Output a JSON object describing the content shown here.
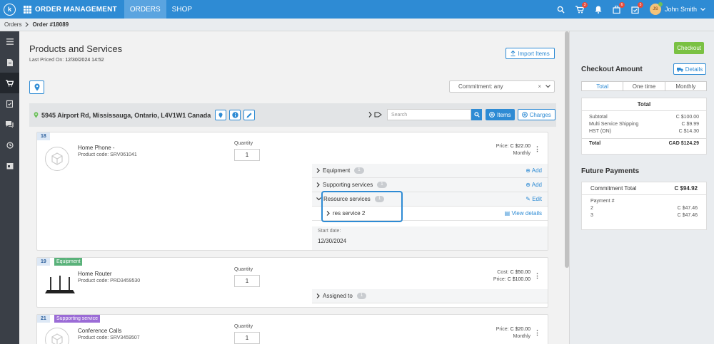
{
  "topbar": {
    "logo": "k",
    "app_title": "ORDER MANAGEMENT",
    "tabs": [
      {
        "label": "ORDERS"
      },
      {
        "label": "SHOP"
      }
    ],
    "badges": {
      "cart": "3",
      "bag": "6",
      "calendar": "5"
    },
    "user_initials": "JS",
    "user_name": "John Smith"
  },
  "breadcrumb": {
    "parent": "Orders",
    "current": "Order #18089"
  },
  "main": {
    "title": "Products and Services",
    "last_priced_label": "Last Priced On:",
    "last_priced_value": "12/30/2024 14:52",
    "import_label": "Import Items",
    "commitment_label": "Commitment: any",
    "address": "5945 Airport Rd, Mississauga, Ontario, L4V1W1 Canada",
    "search_placeholder": "Search",
    "items_label": "Items",
    "charges_label": "Charges"
  },
  "cards": [
    {
      "num": "18",
      "name": "Home Phone -",
      "code_label": "Product code:",
      "code": "SRV061041",
      "qty_label": "Quantity",
      "qty": "1",
      "price_label": "Price:",
      "price": "C $22.00",
      "period": "Monthly",
      "sub": {
        "equipment": "Equipment",
        "equipment_count": "1",
        "supporting": "Supporting services",
        "supporting_count": "1",
        "resource": "Resource services",
        "resource_count": "1",
        "res_service": "res service 2",
        "add": "Add",
        "edit": "Edit",
        "view_details": "View details",
        "start_label": "Start date:",
        "start_value": "12/30/2024"
      }
    },
    {
      "num": "19",
      "tag": "Equipment",
      "name": "Home Router",
      "code_label": "Product code:",
      "code": "PRD3459530",
      "qty_label": "Quantity",
      "qty": "1",
      "cost_label": "Cost:",
      "cost": "C $50.00",
      "price_label": "Price:",
      "price": "C $100.00",
      "assigned": "Assigned to",
      "assigned_count": "1"
    },
    {
      "num": "21",
      "tag": "Supporting service",
      "name": "Conference Calls",
      "code_label": "Product code:",
      "code": "SRV3459507",
      "qty_label": "Quantity",
      "qty": "1",
      "price_label": "Price:",
      "price": "C $20.00",
      "period": "Monthly"
    }
  ],
  "right": {
    "checkout": "Checkout",
    "checkout_amount": "Checkout Amount",
    "details": "Details",
    "tabs": [
      {
        "label": "Total"
      },
      {
        "label": "One time"
      },
      {
        "label": "Monthly"
      }
    ],
    "total_head": "Total",
    "rows": [
      {
        "label": "Subtotal",
        "value": "C $100.00"
      },
      {
        "label": "Multi Service Shipping",
        "value": "C $9.99"
      },
      {
        "label": "HST (ON)",
        "value": "C $14.30"
      }
    ],
    "total_label": "Total",
    "total_value": "CAD $124.29",
    "future_title": "Future Payments",
    "commit_total_label": "Commitment Total",
    "commit_total_value": "C $94.92",
    "payment_label": "Payment #",
    "payments": [
      {
        "num": "2",
        "value": "C $47.46"
      },
      {
        "num": "3",
        "value": "C $47.46"
      }
    ]
  },
  "colors": {
    "brand": "#2e8bd4",
    "checkout": "#7ac143",
    "equipment_tag": "#5ab27a",
    "supporting_tag": "#9b6cd6"
  }
}
